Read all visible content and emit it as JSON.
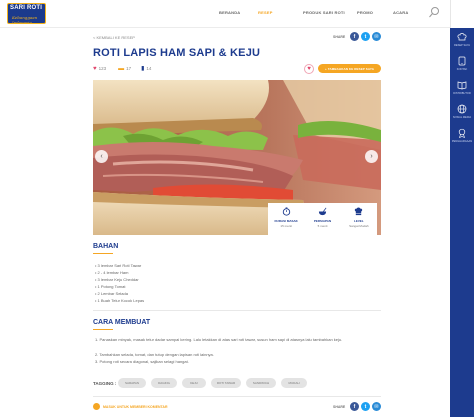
{
  "brand": {
    "line1": "SARI ROTI",
    "line2": "Kebanggaan Indonesia"
  },
  "nav": {
    "items": [
      {
        "label": "BERANDA",
        "active": false
      },
      {
        "label": "RESEP",
        "active": true
      },
      {
        "label": "PRODUK SARI ROTI",
        "active": false
      },
      {
        "label": "PROMO",
        "active": false
      },
      {
        "label": "ACARA",
        "active": false
      }
    ]
  },
  "sidebar": {
    "items": [
      {
        "label": "RESEP SAYA",
        "icon": "chef-hat-icon"
      },
      {
        "label": "KONTAK",
        "icon": "phone-icon"
      },
      {
        "label": "DISTRIBUTOR",
        "icon": "book-icon"
      },
      {
        "label": "SOSIAL MEDIA",
        "icon": "globe-icon"
      },
      {
        "label": "PENGHARGAAN",
        "icon": "award-icon"
      }
    ]
  },
  "breadcrumb": "< KEMBALI KE RESEP",
  "share_label": "SHARE",
  "title": "ROTI LAPIS HAM SAPI & KEJU",
  "stats": {
    "likes": "123",
    "saves": "17",
    "views": "14"
  },
  "add_button": "+ TAMBAHKAN KE RESEP SAYA",
  "info": [
    {
      "label": "DURASI MASAK",
      "value": "15 menit",
      "icon": "timer-icon"
    },
    {
      "label": "PERSIAPAN",
      "value": "5 menit",
      "icon": "bowl-icon"
    },
    {
      "label": "LEVEL",
      "value": "Sangat Mudah",
      "icon": "chef-icon"
    }
  ],
  "ingredients": {
    "title": "BAHAN",
    "items": [
      "3 lembar Sari Roti Tawar",
      "2 - 4 lembar Ham",
      "3 lembar Keju Cheddar",
      "1 Potong Tomat",
      "2 Lembar Selada",
      "1 Buah Telur Kocok Lepas"
    ]
  },
  "method": {
    "title": "CARA MEMBUAT",
    "steps": [
      "1. Panaskan minyak, masak telur dadar sampai kering. Lalu letakkan di atas sari roti tawar, susun ham sapi di atasnya lalu tambahkan keju.",
      "2. Tambahkan selada, tomat, dan tutup dengan lapisan roti lainnya.",
      "3. Potong roti secara diagonal, sajikan selagi hangat."
    ]
  },
  "tagging": {
    "label": "TAGGING :",
    "tags": [
      "SARAPAN",
      "DAGING",
      "KEJU",
      "ROTI TAWAR",
      "SANDWICH",
      "MUDAH"
    ]
  },
  "bottom_link": "MASUK UNTUK MEMBERI KOMENTAR",
  "colors": {
    "primary": "#1d3b8e",
    "accent": "#f5a623"
  }
}
